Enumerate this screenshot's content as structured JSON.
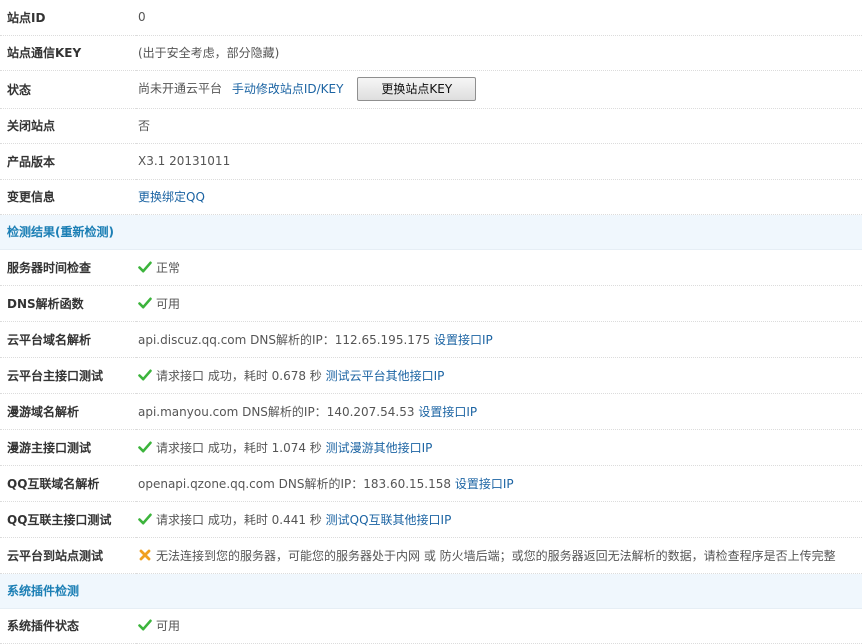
{
  "rows": {
    "site_id": {
      "label": "站点ID",
      "value": "0"
    },
    "site_key": {
      "label": "站点通信KEY",
      "value": "(出于安全考虑，部分隐藏)"
    },
    "status": {
      "label": "状态",
      "value": "尚未开通云平台",
      "link": "手动修改站点ID/KEY",
      "button": "更换站点KEY"
    },
    "close_site": {
      "label": "关闭站点",
      "value": "否"
    },
    "version": {
      "label": "产品版本",
      "value": "X3.1 20131011"
    },
    "change_info": {
      "label": "变更信息",
      "link": "更换绑定QQ"
    }
  },
  "section_detect": {
    "title": "检测结果(重新检测)"
  },
  "detect": {
    "server_time": {
      "label": "服务器时间检查",
      "text": "正常"
    },
    "dns_func": {
      "label": "DNS解析函数",
      "text": "可用"
    },
    "cloud_dns": {
      "label": "云平台域名解析",
      "text": "api.discuz.qq.com DNS解析的IP：112.65.195.175",
      "link": "设置接口IP"
    },
    "cloud_main": {
      "label": "云平台主接口测试",
      "text": "请求接口 成功，耗时 0.678 秒",
      "link": "测试云平台其他接口IP"
    },
    "manyou_dns": {
      "label": "漫游域名解析",
      "text": "api.manyou.com DNS解析的IP：140.207.54.53",
      "link": "设置接口IP"
    },
    "manyou_main": {
      "label": "漫游主接口测试",
      "text": "请求接口 成功，耗时 1.074 秒",
      "link": "测试漫游其他接口IP"
    },
    "qq_dns": {
      "label": "QQ互联域名解析",
      "text": "openapi.qzone.qq.com DNS解析的IP：183.60.15.158",
      "link": "设置接口IP"
    },
    "qq_main": {
      "label": "QQ互联主接口测试",
      "text": "请求接口 成功，耗时 0.441 秒",
      "link": "测试QQ互联其他接口IP"
    },
    "cloud_to_site": {
      "label": "云平台到站点测试",
      "text": "无法连接到您的服务器，可能您的服务器处于内网 或 防火墙后端；或您的服务器返回无法解析的数据，请检查程序是否上传完整"
    }
  },
  "section_plugin": {
    "title": "系统插件检测"
  },
  "plugin": {
    "status": {
      "label": "系统插件状态",
      "text": "可用"
    }
  },
  "icons": {
    "ok": "check-icon",
    "error": "cross-icon",
    "ok_color": "#3cb43c",
    "error_color": "#f0a020"
  }
}
